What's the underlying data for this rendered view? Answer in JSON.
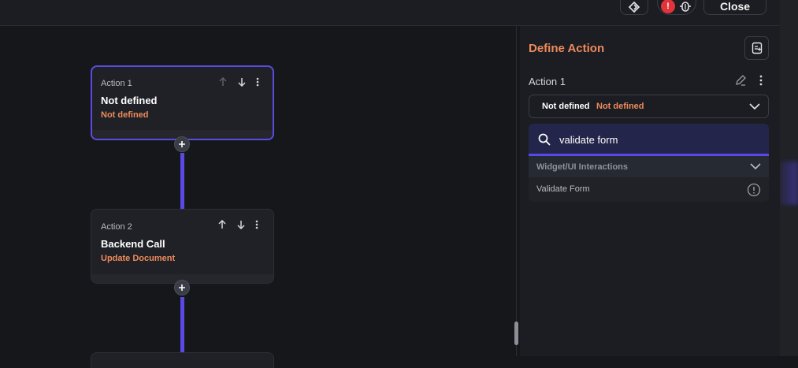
{
  "topbar": {
    "close_label": "Close",
    "badge_count": "!"
  },
  "actions": [
    {
      "label": "Action 1",
      "name": "Not defined",
      "sub": "Not defined"
    },
    {
      "label": "Action 2",
      "name": "Backend Call",
      "sub": "Update Document"
    }
  ],
  "panel": {
    "title": "Define Action",
    "action_label": "Action 1",
    "dropdown_value": "Not defined",
    "dropdown_sub": "Not defined",
    "search_value": "validate form",
    "group_label": "Widget/UI Interactions",
    "result_item": "Validate Form"
  },
  "colors": {
    "accent": "#5a49e6",
    "orange": "#ef8a5b",
    "badge": "#e2333b"
  }
}
